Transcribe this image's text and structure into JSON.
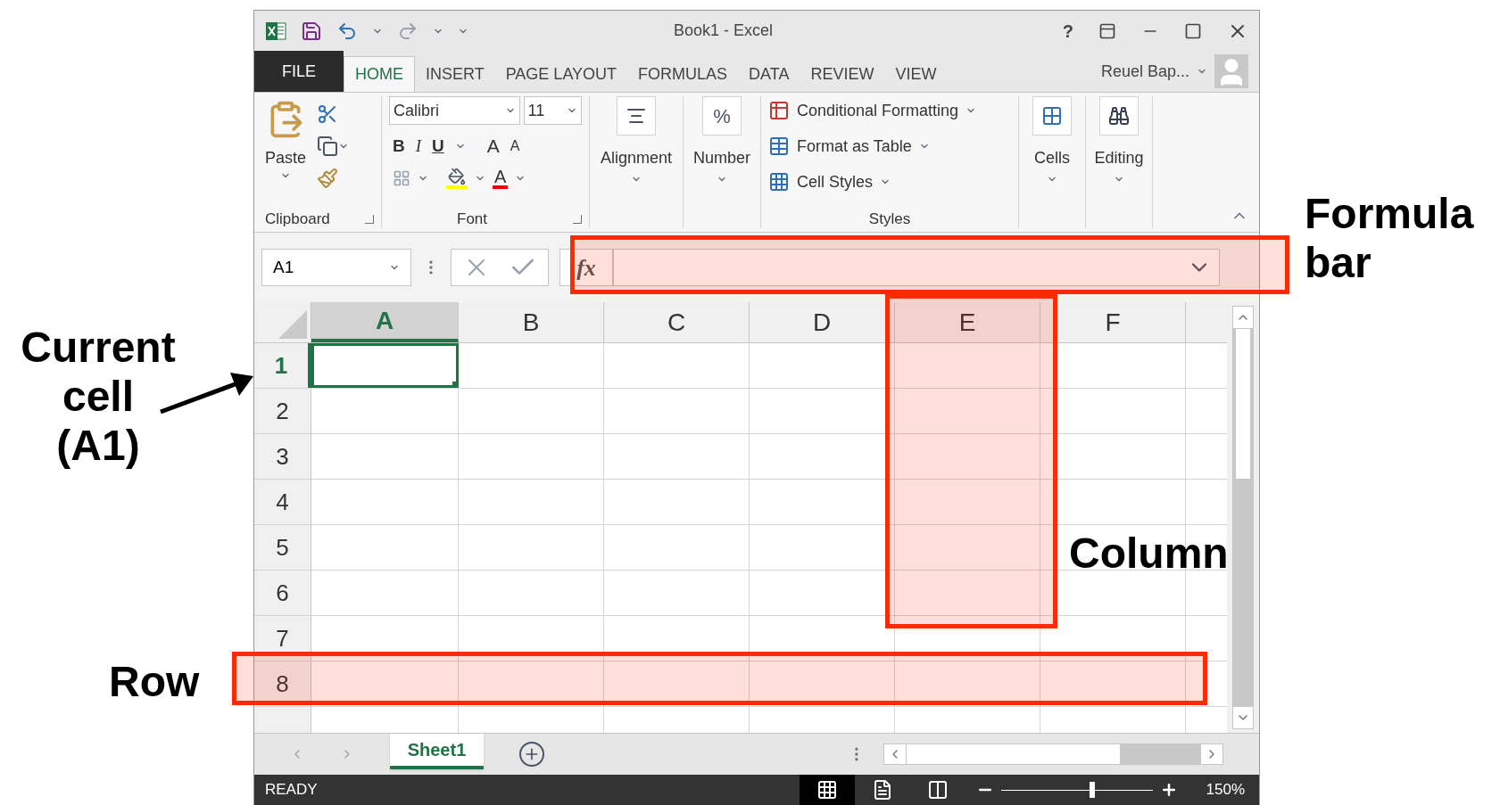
{
  "window": {
    "title": "Book1 - Excel",
    "help": "?",
    "user": "Reuel Bap..."
  },
  "tabs": [
    {
      "label": "FILE",
      "kind": "file",
      "selected": false
    },
    {
      "label": "HOME",
      "kind": "tab",
      "selected": true
    },
    {
      "label": "INSERT",
      "kind": "tab",
      "selected": false
    },
    {
      "label": "PAGE LAYOUT",
      "kind": "tab",
      "selected": false
    },
    {
      "label": "FORMULAS",
      "kind": "tab",
      "selected": false
    },
    {
      "label": "DATA",
      "kind": "tab",
      "selected": false
    },
    {
      "label": "REVIEW",
      "kind": "tab",
      "selected": false
    },
    {
      "label": "VIEW",
      "kind": "tab",
      "selected": false
    }
  ],
  "ribbon": {
    "clipboard": {
      "paste": "Paste",
      "label": "Clipboard"
    },
    "font": {
      "name": "Calibri",
      "size": "11",
      "bold": "B",
      "italic": "I",
      "underline": "U",
      "grow": "A",
      "shrink": "A",
      "text_colour_letter": "A",
      "label": "Font"
    },
    "alignment": "Alignment",
    "number": {
      "symbol": "%",
      "label": "Number"
    },
    "styles": {
      "items": [
        "Conditional Formatting",
        "Format as Table",
        "Cell Styles"
      ],
      "label": "Styles"
    },
    "cells": "Cells",
    "editing": "Editing"
  },
  "formula_bar": {
    "name_box": "A1",
    "function_symbol": "fx"
  },
  "sheet": {
    "columns": [
      {
        "label": "A",
        "selected": true
      },
      {
        "label": "B",
        "selected": false
      },
      {
        "label": "C",
        "selected": false
      },
      {
        "label": "D",
        "selected": false
      },
      {
        "label": "E",
        "selected": false
      },
      {
        "label": "F",
        "selected": false
      }
    ],
    "rows": [
      {
        "label": "1",
        "selected": true
      },
      {
        "label": "2",
        "selected": false
      },
      {
        "label": "3",
        "selected": false
      },
      {
        "label": "4",
        "selected": false
      },
      {
        "label": "5",
        "selected": false
      },
      {
        "label": "6",
        "selected": false
      },
      {
        "label": "7",
        "selected": false
      },
      {
        "label": "8",
        "selected": false
      }
    ]
  },
  "sheet_tabs": [
    {
      "label": "Sheet1",
      "selected": true
    }
  ],
  "status_bar": {
    "status": "READY",
    "views": [
      {
        "kind": "normal",
        "selected": true
      },
      {
        "kind": "page_layout",
        "selected": false
      },
      {
        "kind": "page_break",
        "selected": false
      }
    ],
    "zoom": {
      "level": 0.6,
      "reading": "150%"
    }
  },
  "annotations": [
    {
      "kind": "current_cell",
      "label": "Current cell (A1)"
    },
    {
      "kind": "formula_bar",
      "label": "Formula bar"
    },
    {
      "kind": "column",
      "label": "Column"
    },
    {
      "kind": "row",
      "label": "Row"
    }
  ]
}
